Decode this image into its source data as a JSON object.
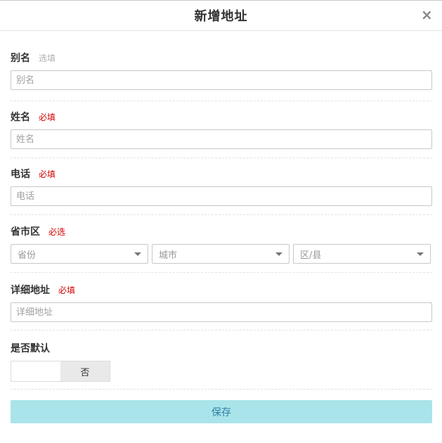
{
  "dialog": {
    "title": "新增地址",
    "close_icon": "close-icon",
    "close_symbol": "×"
  },
  "fields": {
    "alias": {
      "label": "别名",
      "hint": "选填",
      "placeholder": "别名",
      "value": ""
    },
    "name": {
      "label": "姓名",
      "hint": "必填",
      "placeholder": "姓名",
      "value": ""
    },
    "phone": {
      "label": "电话",
      "hint": "必填",
      "placeholder": "电话",
      "value": ""
    },
    "region": {
      "label": "省市区",
      "hint": "必选",
      "province": "省份",
      "city": "城市",
      "district": "区/县"
    },
    "address": {
      "label": "详细地址",
      "hint": "必填",
      "placeholder": "详细地址",
      "value": ""
    },
    "default": {
      "label": "是否默认",
      "yes": "",
      "no": "否"
    }
  },
  "actions": {
    "save_label": "保存"
  },
  "colors": {
    "required": "#d30000",
    "optional": "#b0b0b0",
    "save_bg": "#a9e4ea",
    "save_text": "#2f7fa6"
  }
}
